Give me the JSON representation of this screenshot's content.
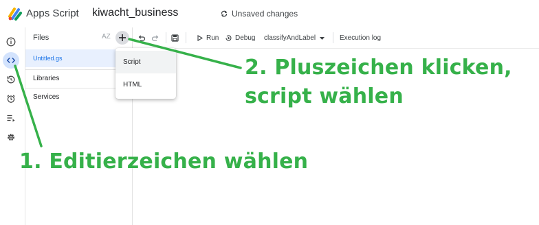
{
  "header": {
    "app_name": "Apps Script",
    "project_name": "kiwacht_business",
    "status": "Unsaved changes"
  },
  "rail": {
    "items": [
      {
        "icon": "info-icon"
      },
      {
        "icon": "code-icon",
        "active": true
      },
      {
        "icon": "history-icon"
      },
      {
        "icon": "alarm-icon"
      },
      {
        "icon": "executions-icon"
      },
      {
        "icon": "gear-icon"
      }
    ]
  },
  "files": {
    "title": "Files",
    "sort_label": "AZ",
    "file_name": "Untitled.gs",
    "libraries": "Libraries",
    "services": "Services"
  },
  "toolbar": {
    "run": "Run",
    "debug": "Debug",
    "function_select": "classifyAndLabel",
    "execution_log": "Execution log"
  },
  "add_menu": {
    "items": [
      "Script",
      "HTML"
    ]
  },
  "annotations": {
    "step2_line1": "2. Pluszeichen klicken,",
    "step2_line2": "script wählen",
    "step1": "1. Editierzeichen wählen"
  },
  "colors": {
    "annotation_green": "#36b14a",
    "active_blue": "#1a73e8",
    "active_bg": "#e8f0fe"
  }
}
